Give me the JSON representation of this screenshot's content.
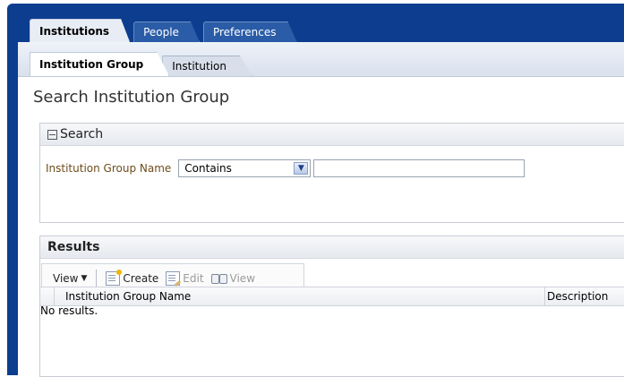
{
  "top_tabs": [
    {
      "label": "Institutions",
      "active": true
    },
    {
      "label": "People",
      "active": false
    },
    {
      "label": "Preferences",
      "active": false
    }
  ],
  "sub_tabs": [
    {
      "label": "Institution Group",
      "active": true
    },
    {
      "label": "Institution",
      "active": false
    }
  ],
  "page_title": "Search Institution Group",
  "search": {
    "header": "Search",
    "field_label": "Institution Group Name",
    "operator_value": "Contains",
    "value": "",
    "icons": {
      "collapse": "collapse-minus-icon",
      "dropdown": "dropdown-arrow-icon"
    }
  },
  "results": {
    "header": "Results",
    "toolbar": {
      "view_label": "View",
      "create_label": "Create",
      "edit_label": "Edit",
      "view_button_label": "View"
    },
    "columns": [
      "Institution Group Name",
      "Description"
    ],
    "empty_text": "No results."
  },
  "colors": {
    "frame_blue": "#0d3d8f",
    "label_brown": "#6e4c1b"
  }
}
